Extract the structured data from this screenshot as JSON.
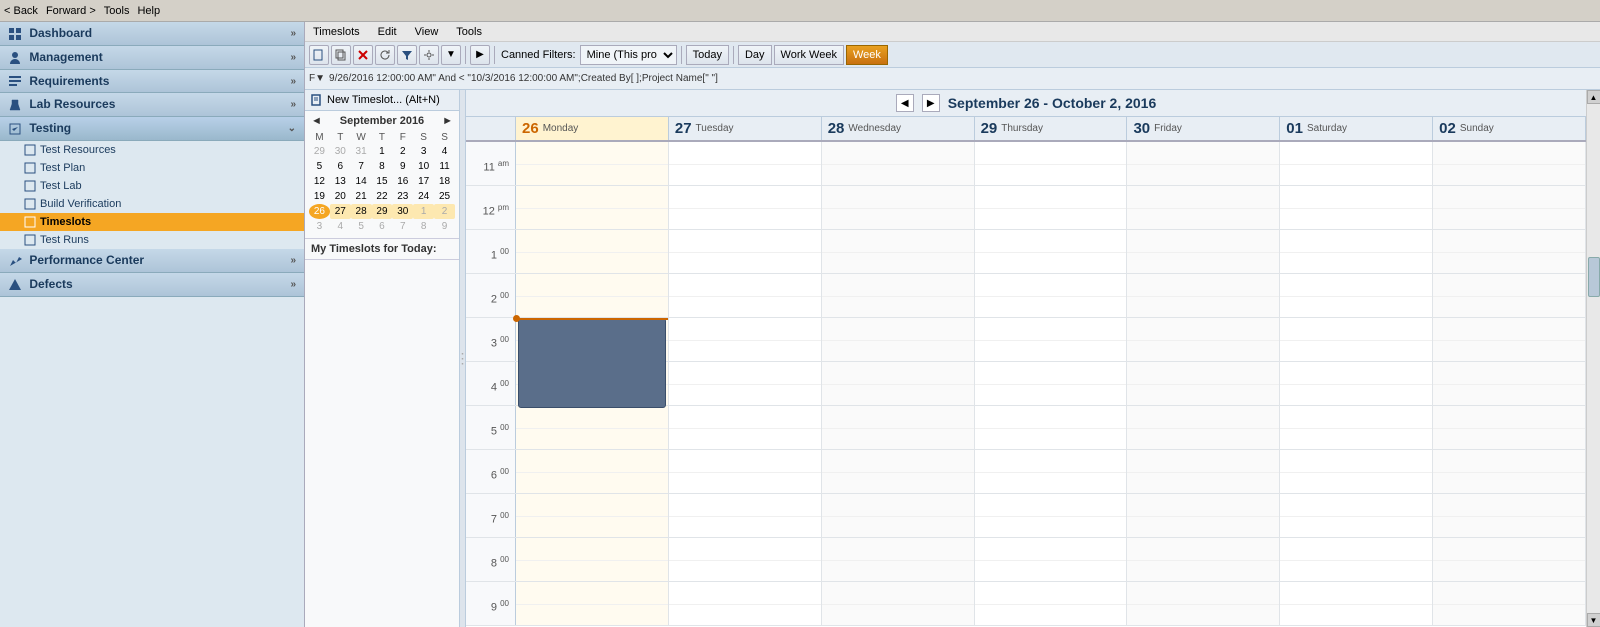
{
  "topbar": {
    "back_label": "< Back",
    "forward_label": "Forward >",
    "tools_label": "Tools",
    "help_label": "Help"
  },
  "sidebar": {
    "sections": [
      {
        "id": "dashboard",
        "label": "Dashboard",
        "icon": "dashboard-icon",
        "items": []
      },
      {
        "id": "management",
        "label": "Management",
        "icon": "management-icon",
        "items": []
      },
      {
        "id": "requirements",
        "label": "Requirements",
        "icon": "requirements-icon",
        "items": []
      },
      {
        "id": "lab-resources",
        "label": "Lab Resources",
        "icon": "lab-icon",
        "items": []
      },
      {
        "id": "testing",
        "label": "Testing",
        "icon": "testing-icon",
        "items": [
          {
            "id": "test-resources",
            "label": "Test Resources"
          },
          {
            "id": "test-plan",
            "label": "Test Plan"
          },
          {
            "id": "test-lab",
            "label": "Test Lab"
          },
          {
            "id": "build-verification",
            "label": "Build Verification"
          },
          {
            "id": "timeslots",
            "label": "Timeslots",
            "active": true
          },
          {
            "id": "test-runs",
            "label": "Test Runs"
          }
        ]
      },
      {
        "id": "performance-center",
        "label": "Performance Center",
        "icon": "perf-icon",
        "items": []
      },
      {
        "id": "defects",
        "label": "Defects",
        "icon": "defects-icon",
        "items": []
      }
    ]
  },
  "menubar": {
    "items": [
      "Timeslots",
      "Edit",
      "View",
      "Tools"
    ]
  },
  "toolbar": {
    "new_button": "New Timeslot...  (Alt+N)",
    "canned_filters_label": "Canned Filters:",
    "mine_label": "Mine (This pro",
    "today_btn": "Today",
    "day_btn": "Day",
    "work_week_btn": "Work Week",
    "week_btn": "Week"
  },
  "filter_bar": {
    "text": "9/26/2016 12:00:00 AM\" And < \"10/3/2016 12:00:00 AM\";Created By[          ];Project Name[\"          \"]"
  },
  "mini_calendar": {
    "title": "September 2016",
    "days_header": [
      "M",
      "T",
      "W",
      "T",
      "F",
      "S",
      "S"
    ],
    "weeks": [
      [
        "29",
        "30",
        "31",
        "1",
        "2",
        "3",
        "4"
      ],
      [
        "5",
        "6",
        "7",
        "8",
        "9",
        "10",
        "11"
      ],
      [
        "12",
        "13",
        "14",
        "15",
        "16",
        "17",
        "18"
      ],
      [
        "19",
        "20",
        "21",
        "22",
        "23",
        "24",
        "25"
      ],
      [
        "26",
        "27",
        "28",
        "29",
        "30",
        "1",
        "2"
      ],
      [
        "3",
        "4",
        "5",
        "6",
        "7",
        "8",
        "9"
      ]
    ],
    "other_month_indices": {
      "0": [
        0,
        1,
        2
      ],
      "4": [
        3,
        4,
        5,
        6
      ],
      "5": [
        0,
        1,
        2,
        3,
        4,
        5,
        6
      ]
    },
    "today_week": 4,
    "today_day_in_week": 0,
    "selected_week": 4
  },
  "my_timeslots_label": "My Timeslots for Today:",
  "week_view": {
    "title": "September 26 - October 2, 2016",
    "days": [
      {
        "number": "26",
        "name": "Monday",
        "is_today": true
      },
      {
        "number": "27",
        "name": "Tuesday",
        "is_today": false
      },
      {
        "number": "28",
        "name": "Wednesday",
        "is_today": false
      },
      {
        "number": "29",
        "name": "Thursday",
        "is_today": false
      },
      {
        "number": "30",
        "name": "Friday",
        "is_today": false
      },
      {
        "number": "01",
        "name": "Saturday",
        "is_today": false
      },
      {
        "number": "02",
        "name": "Sunday",
        "is_today": false
      }
    ],
    "hours": [
      {
        "label": "11",
        "ampm": "am"
      },
      {
        "label": "12",
        "ampm": "pm"
      },
      {
        "label": "1",
        "ampm": "00"
      },
      {
        "label": "2",
        "ampm": "00"
      },
      {
        "label": "3",
        "ampm": "00"
      },
      {
        "label": "4",
        "ampm": "00"
      },
      {
        "label": "5",
        "ampm": "00"
      },
      {
        "label": "6",
        "ampm": "00"
      },
      {
        "label": "7",
        "ampm": "00"
      },
      {
        "label": "8",
        "ampm": "00"
      },
      {
        "label": "9",
        "ampm": "00"
      }
    ],
    "event": {
      "top_offset_pct": "58",
      "height_pct": "12",
      "day_index": 0
    }
  }
}
